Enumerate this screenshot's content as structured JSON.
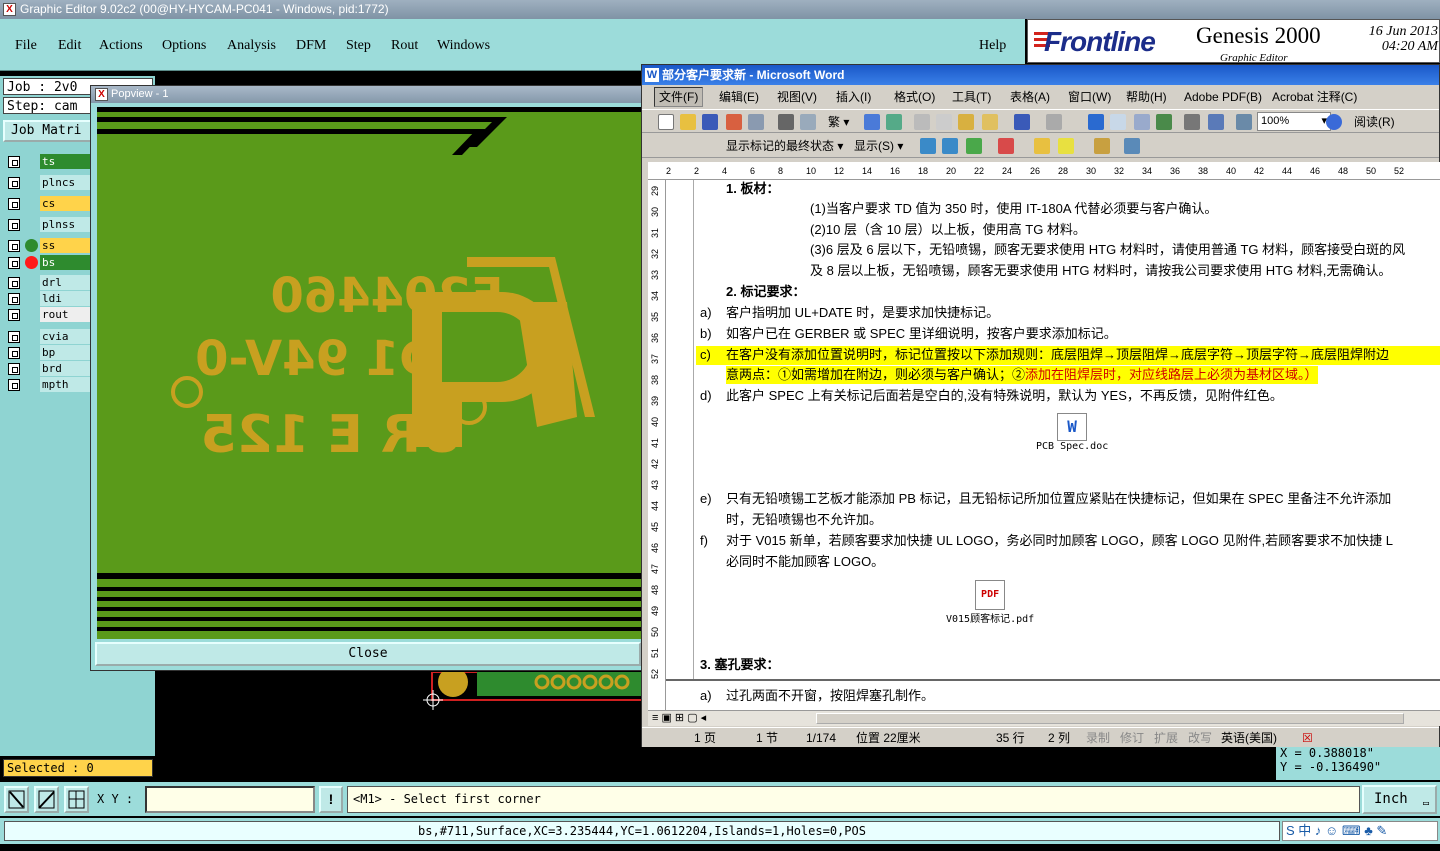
{
  "genesis": {
    "window_title": "Graphic Editor 9.02c2 (00@HY-HYCAM-PC041 - Windows, pid:1772)",
    "menu": [
      "File",
      "Edit",
      "Actions",
      "Options",
      "Analysis",
      "DFM",
      "Step",
      "Rout",
      "Windows"
    ],
    "help": "Help",
    "logo_brand": "Frontline",
    "product_name": "Genesis 2000",
    "product_sub": "Graphic Editor",
    "date": "16 Jun 2013",
    "time": "04:20 AM",
    "job_label": "Job : 2v0",
    "step_label": "Step: cam",
    "job_matrix_button": "Job Matri",
    "layers": [
      {
        "name": "ts",
        "color": "#2e8b2e",
        "text_color": "#fff",
        "dot": ""
      },
      {
        "name": "plncs",
        "color": "#bfe9e7",
        "text_color": "#000",
        "dot": ""
      },
      {
        "name": "cs",
        "color": "#ffd34a",
        "text_color": "#000",
        "dot": ""
      },
      {
        "name": "plnss",
        "color": "#bfe9e7",
        "text_color": "#000",
        "dot": ""
      },
      {
        "name": "ss",
        "color": "#ffd34a",
        "text_color": "#000",
        "dot": "#2e8b2e"
      },
      {
        "name": "bs",
        "color": "#2e8b2e",
        "text_color": "#fff",
        "dot": "#ff1a1a"
      },
      {
        "name": "drl",
        "color": "#bfe9e7",
        "text_color": "#000",
        "dot": ""
      },
      {
        "name": "ldi",
        "color": "#bfe9e7",
        "text_color": "#000",
        "dot": ""
      },
      {
        "name": "rout",
        "color": "#eeeeee",
        "text_color": "#000",
        "dot": ""
      },
      {
        "name": "cvia",
        "color": "#bfe9e7",
        "text_color": "#000",
        "dot": ""
      },
      {
        "name": "bp",
        "color": "#bfe9e7",
        "text_color": "#000",
        "dot": ""
      },
      {
        "name": "brd",
        "color": "#bfe9e7",
        "text_color": "#000",
        "dot": ""
      },
      {
        "name": "mpth",
        "color": "#bfe9e7",
        "text_color": "#000",
        "dot": ""
      }
    ],
    "selected": "Selected : 0",
    "xy_label": "X Y :",
    "xy_value": "",
    "bang": "!",
    "prompt": "<M1> - Select first corner",
    "units": "Inch",
    "coord_x": "X = 0.388018\"",
    "coord_y": "Y = -0.136490\"",
    "status": "bs,#711,Surface,XC=3.235444,YC=1.0612204,Islands=1,Holes=0,POS",
    "tray": "S 中 ♪ ☺ ⌨ ♣ ✎"
  },
  "popview": {
    "title": "Popview - 1",
    "close_label": "Close",
    "silk_line1": "E204460",
    "silk_line2": "D1 94V-0",
    "silk_line3": "UR E 125",
    "colors": {
      "board": "#5a9a1a",
      "copper": "#c8a020",
      "trace": "#000000"
    }
  },
  "word": {
    "title": "部分客户要求新 - Microsoft Word",
    "menu": [
      "文件(F)",
      "编辑(E)",
      "视图(V)",
      "插入(I)",
      "格式(O)",
      "工具(T)",
      "表格(A)",
      "窗口(W)",
      "帮助(H)",
      "Adobe PDF(B)",
      "Acrobat 注释(C)"
    ],
    "zoom": "100%",
    "read_button": "阅读(R)",
    "markup_dropdown": "显示标记的最终状态",
    "show_dropdown": "显示(S)",
    "ruler_ticks": [
      "2",
      "2",
      "4",
      "6",
      "8",
      "10",
      "12",
      "14",
      "16",
      "18",
      "20",
      "22",
      "24",
      "26",
      "28",
      "30",
      "32",
      "34",
      "36",
      "38",
      "40",
      "42",
      "44",
      "46",
      "48",
      "50",
      "52"
    ],
    "vruler_ticks": [
      "29",
      "30",
      "31",
      "32",
      "33",
      "34",
      "35",
      "36",
      "37",
      "38",
      "39",
      "40",
      "41",
      "42",
      "43",
      "44",
      "45",
      "46",
      "47",
      "48",
      "49",
      "50",
      "51",
      "52"
    ],
    "doc": {
      "h1": "1.  板材：",
      "p1": "(1)当客户要求 TD 值为 350 时，使用 IT-180A 代替必须要与客户确认。",
      "p2": "(2)10 层（含 10 层）以上板，使用高 TG 材料。",
      "p3": "(3)6 层及 6 层以下，无铅喷锡，顾客无要求使用 HTG 材料时，请使用普通 TG 材料，顾客接受白斑的风",
      "p3b": "及 8 层以上板，无铅喷锡，顾客无要求使用 HTG 材料时，请按我公司要求使用 HTG 材料,无需确认。",
      "h2": "2.  标记要求：",
      "a": "客户指明加 UL+DATE 时，是要求加快捷标记。",
      "b": "如客户已在 GERBER 或 SPEC 里详细说明，按客户要求添加标记。",
      "c1": "在客户没有添加位置说明时，标记位置按以下添加规则：底层阻焊→顶层阻焊→底层字符→顶层字符→底层阻焊附边",
      "c2a": "意两点：①如需增加在附边，则必须与客户确认；②",
      "c2b": "添加在阻焊层时，对应线路层上必须为基材区域。）",
      "d": "此客户  SPEC 上有关标记后面若是空白的,没有特殊说明，默认为 YES，不再反馈，见附件红色。",
      "attach1": "PCB Spec.doc",
      "e1": "只有无铅喷锡工艺板才能添加 PB 标记，且无铅标记所加位置应紧贴在快捷标记，但如果在 SPEC 里备注不允许添加",
      "e2": "时，无铅喷锡也不允许加。",
      "f1": "对于 V015 新单，若顾客要求加快捷 UL LOGO，务必同时加顾客 LOGO，顾客 LOGO 见附件,若顾客要求不加快捷 L",
      "f2": "必同时不能加顾客 LOGO。",
      "attach2": "V015顾客标记.pdf",
      "h3": "3.  塞孔要求：",
      "g": "过孔两面不开窗，按阻焊塞孔制作。",
      "labels": [
        "a)",
        "b)",
        "c)",
        "d)",
        "e)",
        "f)",
        "a)"
      ]
    },
    "status": {
      "page": "1 页",
      "section": "1 节",
      "pages": "1/174",
      "position": "位置 22厘米",
      "line": "35 行",
      "col": "2 列",
      "rec": "录制",
      "trk": "修订",
      "ext": "扩展",
      "ovr": "改写",
      "lang": "英语(美国)"
    }
  }
}
